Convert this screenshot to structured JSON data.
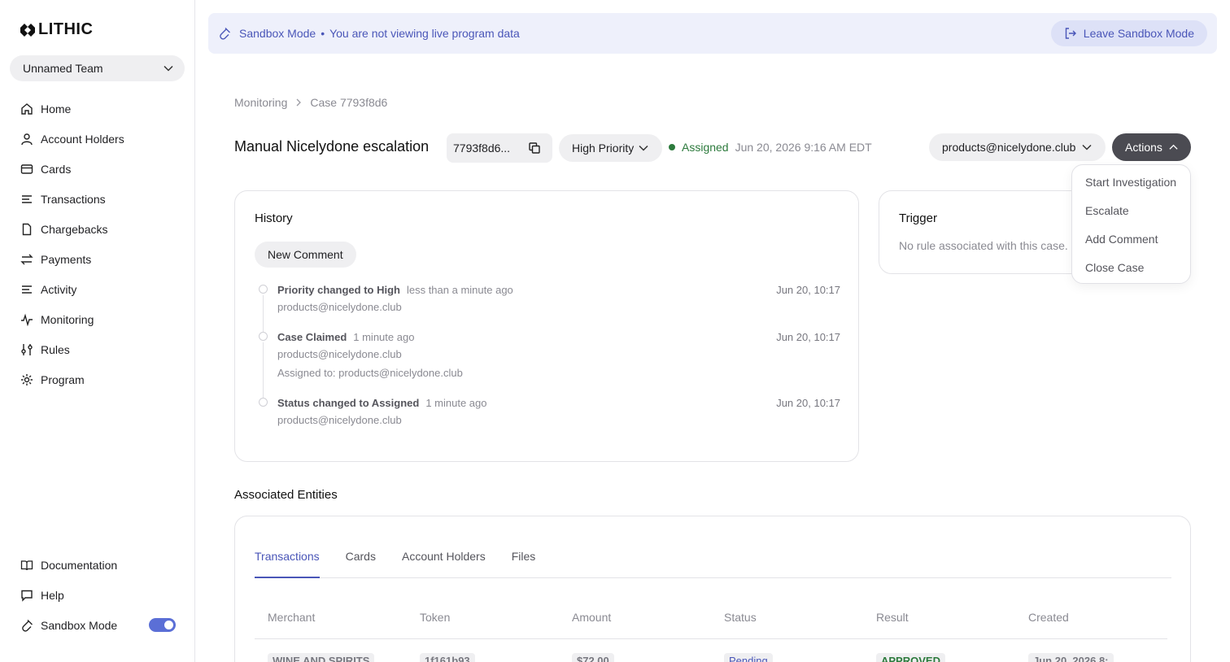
{
  "brand": {
    "logo_text": "LITHIC"
  },
  "team": {
    "name": "Unnamed Team"
  },
  "sidebar": {
    "items": [
      {
        "label": "Home",
        "icon": "home-icon"
      },
      {
        "label": "Account Holders",
        "icon": "user-icon"
      },
      {
        "label": "Cards",
        "icon": "card-icon"
      },
      {
        "label": "Transactions",
        "icon": "list-icon"
      },
      {
        "label": "Chargebacks",
        "icon": "file-icon"
      },
      {
        "label": "Payments",
        "icon": "arrows-icon"
      },
      {
        "label": "Activity",
        "icon": "list-icon"
      },
      {
        "label": "Monitoring",
        "icon": "pulse-icon"
      },
      {
        "label": "Rules",
        "icon": "sliders-icon"
      },
      {
        "label": "Program",
        "icon": "gear-icon"
      }
    ],
    "bottom": [
      {
        "label": "Documentation",
        "icon": "book-icon"
      },
      {
        "label": "Help",
        "icon": "chat-icon"
      },
      {
        "label": "Sandbox Mode",
        "icon": "flask-icon",
        "toggle_on": true
      }
    ]
  },
  "banner": {
    "mode": "Sandbox Mode",
    "separator": "•",
    "message": "You are not viewing live program data",
    "leave_label": "Leave Sandbox Mode"
  },
  "breadcrumb": {
    "parent": "Monitoring",
    "current": "Case 7793f8d6"
  },
  "case": {
    "title": "Manual Nicelydone escalation",
    "id_short": "7793f8d6...",
    "priority": "High Priority",
    "status": "Assigned",
    "status_date": "Jun 20, 2026 9:16 AM EDT",
    "assignee": "products@nicelydone.club",
    "actions_label": "Actions"
  },
  "actions_menu": [
    "Start Investigation",
    "Escalate",
    "Add Comment",
    "Close Case"
  ],
  "history": {
    "title": "History",
    "new_comment_label": "New Comment",
    "events": [
      {
        "event": "Priority changed to High",
        "ago": "less than a minute ago",
        "time": "Jun 20, 10:17",
        "lines": [
          "products@nicelydone.club"
        ]
      },
      {
        "event": "Case Claimed",
        "ago": "1 minute ago",
        "time": "Jun 20, 10:17",
        "lines": [
          "products@nicelydone.club",
          "Assigned to: products@nicelydone.club"
        ]
      },
      {
        "event": "Status changed to Assigned",
        "ago": "1 minute ago",
        "time": "Jun 20, 10:17",
        "lines": [
          "products@nicelydone.club"
        ]
      }
    ]
  },
  "trigger": {
    "title": "Trigger",
    "text": "No rule associated with this case."
  },
  "associated": {
    "title": "Associated Entities",
    "tabs": [
      "Transactions",
      "Cards",
      "Account Holders",
      "Files"
    ],
    "active_tab": "Transactions",
    "columns": [
      "Merchant",
      "Token",
      "Amount",
      "Status",
      "Result",
      "Created"
    ],
    "row": [
      "WINE AND SPIRITS",
      "1f161b93",
      "$72.00",
      "Pending",
      "APPROVED",
      "Jun 20, 2026 8:"
    ]
  },
  "colors": {
    "accent": "#4a56b8",
    "success": "#2c7a3c",
    "dark_button": "#4b4b52"
  }
}
